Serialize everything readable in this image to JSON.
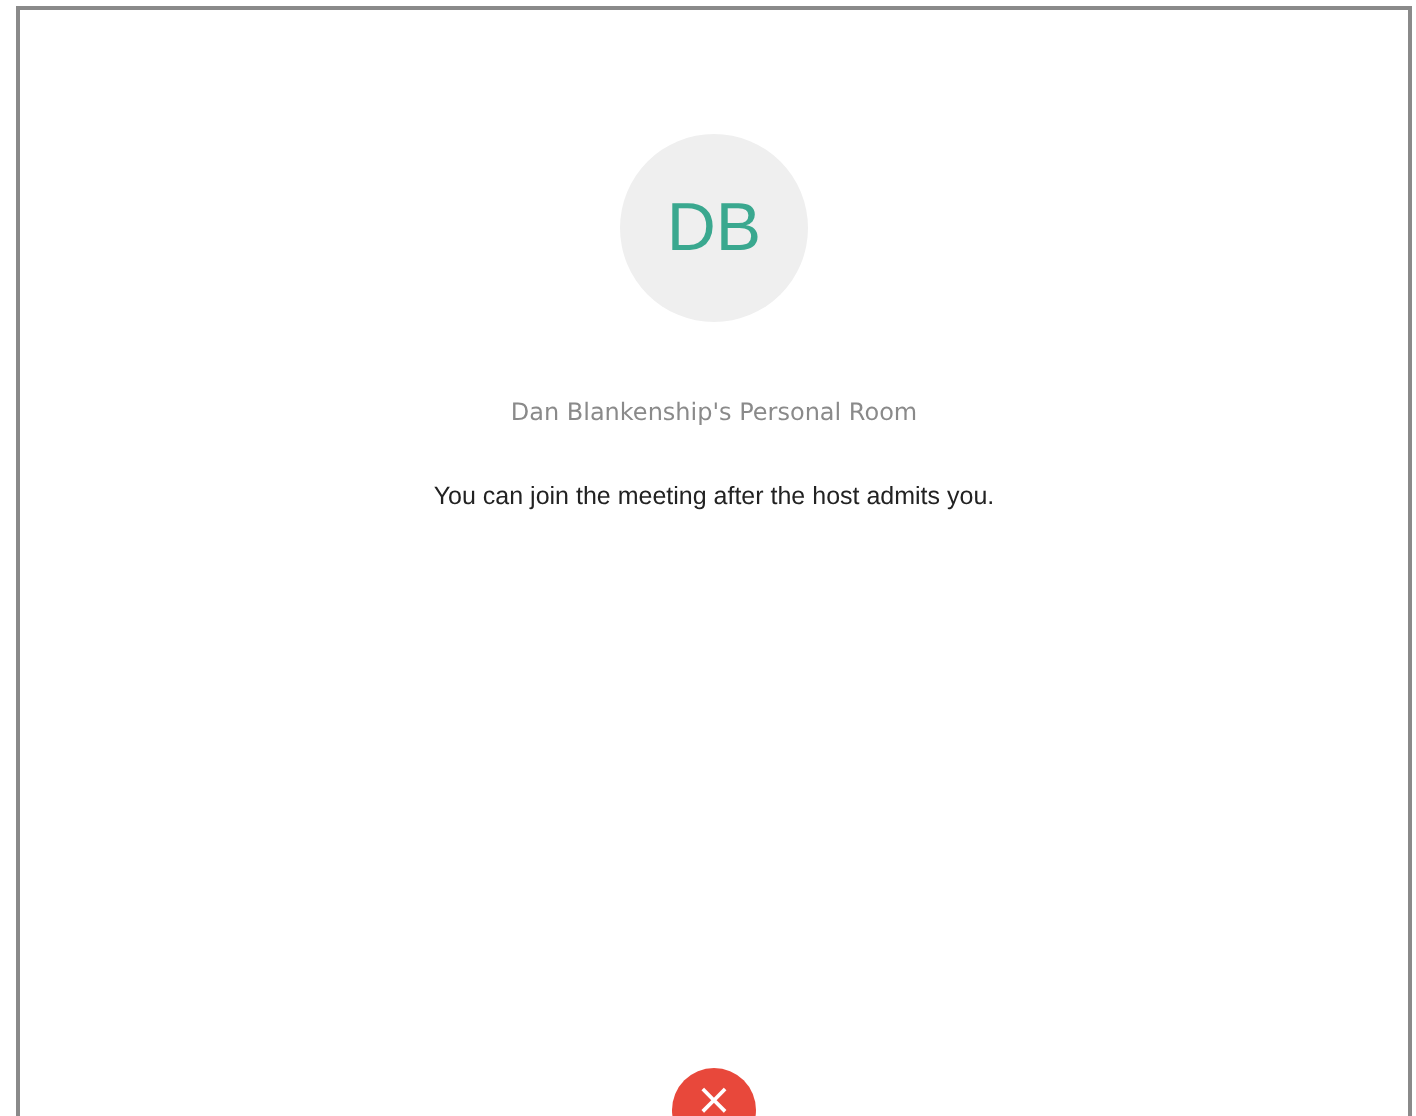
{
  "avatar": {
    "initials": "DB"
  },
  "room_name": "Dan Blankenship's Personal Room",
  "message": "You can join the meeting after the host admits you.",
  "leave_button": {
    "symbol": "×"
  }
}
